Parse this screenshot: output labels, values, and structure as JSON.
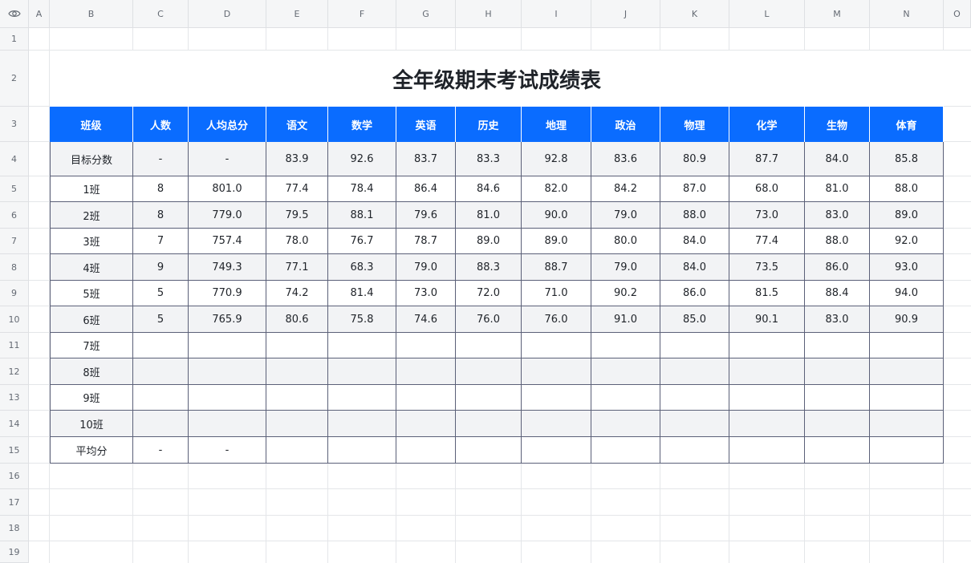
{
  "columns": [
    "A",
    "B",
    "C",
    "D",
    "E",
    "F",
    "G",
    "H",
    "I",
    "J",
    "K",
    "L",
    "M",
    "N",
    "O"
  ],
  "rows": [
    "1",
    "2",
    "3",
    "4",
    "5",
    "6",
    "7",
    "8",
    "9",
    "10",
    "11",
    "12",
    "13",
    "14",
    "15",
    "16",
    "17",
    "18",
    "19"
  ],
  "title": "全年级期末考试成绩表",
  "headers": [
    "班级",
    "人数",
    "人均总分",
    "语文",
    "数学",
    "英语",
    "历史",
    "地理",
    "政治",
    "物理",
    "化学",
    "生物",
    "体育"
  ],
  "table_rows": [
    [
      "目标分数",
      "-",
      "-",
      "83.9",
      "92.6",
      "83.7",
      "83.3",
      "92.8",
      "83.6",
      "80.9",
      "87.7",
      "84.0",
      "85.8"
    ],
    [
      "1班",
      "8",
      "801.0",
      "77.4",
      "78.4",
      "86.4",
      "84.6",
      "82.0",
      "84.2",
      "87.0",
      "68.0",
      "81.0",
      "88.0"
    ],
    [
      "2班",
      "8",
      "779.0",
      "79.5",
      "88.1",
      "79.6",
      "81.0",
      "90.0",
      "79.0",
      "88.0",
      "73.0",
      "83.0",
      "89.0"
    ],
    [
      "3班",
      "7",
      "757.4",
      "78.0",
      "76.7",
      "78.7",
      "89.0",
      "89.0",
      "80.0",
      "84.0",
      "77.4",
      "88.0",
      "92.0"
    ],
    [
      "4班",
      "9",
      "749.3",
      "77.1",
      "68.3",
      "79.0",
      "88.3",
      "88.7",
      "79.0",
      "84.0",
      "73.5",
      "86.0",
      "93.0"
    ],
    [
      "5班",
      "5",
      "770.9",
      "74.2",
      "81.4",
      "73.0",
      "72.0",
      "71.0",
      "90.2",
      "86.0",
      "81.5",
      "88.4",
      "94.0"
    ],
    [
      "6班",
      "5",
      "765.9",
      "80.6",
      "75.8",
      "74.6",
      "76.0",
      "76.0",
      "91.0",
      "85.0",
      "90.1",
      "83.0",
      "90.9"
    ],
    [
      "7班",
      "",
      "",
      "",
      "",
      "",
      "",
      "",
      "",
      "",
      "",
      "",
      ""
    ],
    [
      "8班",
      "",
      "",
      "",
      "",
      "",
      "",
      "",
      "",
      "",
      "",
      "",
      ""
    ],
    [
      "9班",
      "",
      "",
      "",
      "",
      "",
      "",
      "",
      "",
      "",
      "",
      "",
      ""
    ],
    [
      "10班",
      "",
      "",
      "",
      "",
      "",
      "",
      "",
      "",
      "",
      "",
      "",
      ""
    ],
    [
      "平均分",
      "-",
      "-",
      "",
      "",
      "",
      "",
      "",
      "",
      "",
      "",
      "",
      ""
    ]
  ],
  "colors": {
    "header_bg": "#0a6cff",
    "shaded_row": "#f2f3f5",
    "border": "#5b6078"
  },
  "icons": {
    "corner": "eye-icon"
  }
}
